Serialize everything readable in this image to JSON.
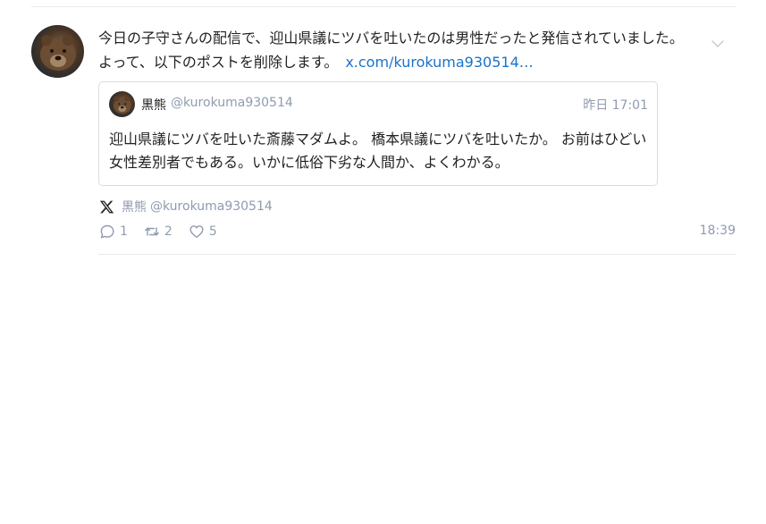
{
  "post": {
    "text": "今日の子守さんの配信で、迎山県議にツバを吐いたのは男性だったと発信されていました。 よって、以下のポストを削除します。",
    "link": "x.com/kurokuma930514…",
    "time": "18:39",
    "source": {
      "icon": "x-logo-icon",
      "name": "黒熊",
      "handle": "@kurokuma930514"
    },
    "actions": {
      "reply_count": "1",
      "repost_count": "2",
      "like_count": "5"
    }
  },
  "quote": {
    "name": "黒熊",
    "handle": "@kurokuma930514",
    "time": "昨日 17:01",
    "text": "迎山県議にツバを吐いた斎藤マダムよ。 橋本県議にツバを吐いたか。 お前はひどい女性差別者でもある。いかに低俗下劣な人間か、よくわかる。"
  },
  "colors": {
    "link": "#1a73c8",
    "muted": "#8f9bb0",
    "text": "#222222",
    "border": "#dcdcdc"
  }
}
